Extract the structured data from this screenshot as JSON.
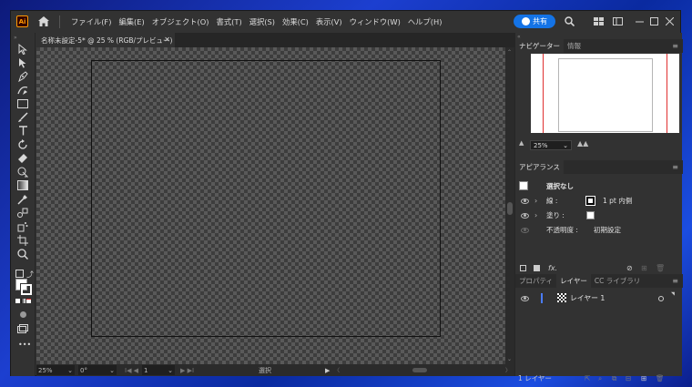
{
  "app": {
    "logo": "Ai"
  },
  "menu": [
    "ファイル(F)",
    "編集(E)",
    "オブジェクト(O)",
    "書式(T)",
    "選択(S)",
    "効果(C)",
    "表示(V)",
    "ウィンドウ(W)",
    "ヘルプ(H)"
  ],
  "share": {
    "label": "共有"
  },
  "document": {
    "tab_title": "名称未設定-5* @ 25 % (RGB/プレビュー)"
  },
  "status": {
    "zoom": "25%",
    "rotation": "0°",
    "artboard": "1",
    "mode": "選択"
  },
  "navigator": {
    "tab": "ナビゲーター",
    "info_tab": "情報",
    "zoom": "25%"
  },
  "appearance": {
    "title": "アピアランス",
    "selection": "選択なし",
    "stroke_label": "線 :",
    "stroke_value": "1 pt  内側",
    "fill_label": "塗り :",
    "opacity_label": "不透明度 :",
    "opacity_value": "初期設定",
    "fx": "fx."
  },
  "layers_panel": {
    "tabs": [
      "プロパティ",
      "レイヤー",
      "CC ライブラリ"
    ],
    "layer_name": "レイヤー 1",
    "count": "1 レイヤー"
  },
  "colors": {
    "accent": "#1473e6",
    "artboard_marker": "#e03030",
    "layer_color": "#4a7cff"
  }
}
